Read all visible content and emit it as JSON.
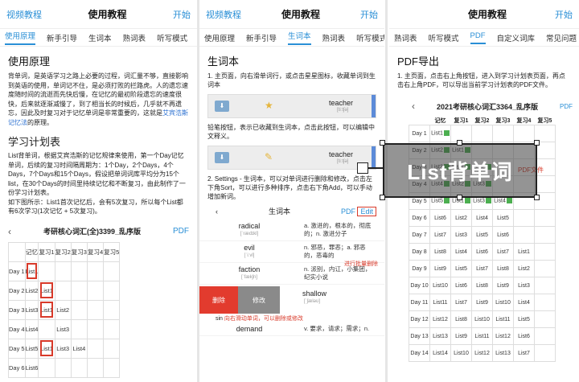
{
  "panel1": {
    "top_left": "视频教程",
    "title": "使用教程",
    "top_right": "开始",
    "tabs": [
      "使用原理",
      "新手引导",
      "生词本",
      "熟词表",
      "听写模式"
    ],
    "heading": "使用原理",
    "para1": "背单词，是英语学习之路上必要的过程，词汇量不够，直接影响到英语的使用，单词记不住，是必须打败的拦路虎。人的遗忘速度随时间的流逝而先快后慢，在记忆的最初阶段遗忘的速度很快，后来就逐渐减慢了，到了相当长的时候后，几乎就不再遗忘，因此及时复习对于记忆单词是非常重要的，这就是",
    "para1_link": "艾宾浩斯记忆法",
    "para1_end": "的原理。",
    "sub_heading": "学习计划表",
    "para2": "List背单词，根据艾宾浩斯的记忆规律来使用，第一个Day记忆单词，后续的复习时间隔周期为：1个Day，2个Days，4个Days，7个Days和15个Days，假设把单词词库平均分为15个list，在30个Days的时间里持续记忆和不断复习，由此制作了一份学习计划表。",
    "para3": "如下图所示：List1首次记忆后，会有5次复习，所以每个List都有6次学习(1次记忆 + 5次复习)。",
    "table_title": "考研核心词汇(全)3399_乱序版",
    "table_back": "‹",
    "table_pdf": "PDF",
    "table_headers": [
      "",
      "记忆",
      "复习1",
      "复习2",
      "复习3",
      "复习4",
      "复习5"
    ],
    "table_rows": [
      [
        "Day 1",
        "List1",
        "",
        "",
        "",
        "",
        ""
      ],
      [
        "Day 2",
        "List2",
        "List1",
        "",
        "",
        "",
        ""
      ],
      [
        "Day 3",
        "List3",
        "List1",
        "List2",
        "",
        "",
        ""
      ],
      [
        "Day 4",
        "List4",
        "",
        "List3",
        "",
        "",
        ""
      ],
      [
        "Day 5",
        "List5",
        "List1",
        "List3",
        "List4",
        "",
        ""
      ],
      [
        "Day 6",
        "List6",
        "",
        "",
        "",
        "",
        ""
      ]
    ]
  },
  "panel2": {
    "top_left": "视频教程",
    "title": "使用教程",
    "top_right": "开始",
    "tabs": [
      "使用原理",
      "新手引导",
      "生词本",
      "熟词表",
      "听写模式"
    ],
    "heading": "生词本",
    "step1": "1. 主页面，向右滑单词行，或点击星星图标，收藏单词到生词本",
    "shot1_word": "teacher",
    "shot1_ipa": "[tiːtʃə]",
    "step1b": "铅笔按钮，表示已收藏到生词本，点击此按钮，可以编辑中文释义。",
    "shot2_word": "teacher",
    "shot2_ipa": "[tiːtʃə]",
    "step2": "2. Settings - 生词本，可以对单词进行删除和修改，点击左下角Sort，可以进行多种排序，点击右下角Add，可以手动增加新词。",
    "wl_title": "生词本",
    "wl_pdf": "PDF",
    "wl_edit": "Edit",
    "wl_rows": [
      {
        "w": "radical",
        "ipa": "[ˈrædɪkl]",
        "def": "a. 激进的，根本的，彻底的；n. 激进分子"
      },
      {
        "w": "evil",
        "ipa": "[ˈiːvl]",
        "def": "n. 邪恶，罪恶；a. 邪恶的，恶毒的"
      },
      {
        "w": "faction",
        "ipa": "[ˈfækʃn]",
        "def": "n. 派别，内讧，小集团，纪实小说"
      }
    ],
    "annot1": "进行批量删除",
    "swipe_del": "删除",
    "swipe_mod": "修改",
    "swipe_word": "shallow",
    "swipe_ipa": "[ˈʃæləʊ]",
    "swipe_word2": "sin",
    "annot2": "向右滑动单词，可以删除或修改",
    "last_w": "demand",
    "last_def": "v. 要求，请求；需求；n."
  },
  "panel3": {
    "top_right": "开始",
    "title": "使用教程",
    "tabs": [
      "熟词表",
      "听写模式",
      "PDF",
      "自定义词库",
      "常见问题"
    ],
    "heading": "PDF导出",
    "step1": "1. 主页面，点击右上角按钮，进入到学习计划表页面，再点击右上角PDF，可以导出当前学习计划表的PDF文件。",
    "table_title": "2021考研核心词汇3364_乱序版",
    "table_back": "‹",
    "table_pdf": "PDF",
    "pdf_note": "PDF文件",
    "overlay_label": "List背单词",
    "headers": [
      "",
      "记忆",
      "复习1",
      "复习2",
      "复习3",
      "复习4",
      "复习5"
    ],
    "rows": [
      [
        "Day 1",
        "List1",
        "",
        "",
        "",
        "",
        ""
      ],
      [
        "Day 2",
        "List2",
        "List1",
        "",
        "",
        "",
        ""
      ],
      [
        "Day 3",
        "List3",
        "List1",
        "List2",
        "",
        "",
        ""
      ],
      [
        "Day 4",
        "List4",
        "List2",
        "List3",
        "",
        "",
        ""
      ],
      [
        "Day 5",
        "List5",
        "List1",
        "List3",
        "List4",
        "",
        ""
      ],
      [
        "Day 6",
        "List6",
        "List2",
        "List4",
        "List5",
        "",
        ""
      ],
      [
        "Day 7",
        "List7",
        "List3",
        "List5",
        "List6",
        "",
        ""
      ],
      [
        "Day 8",
        "List8",
        "List4",
        "List6",
        "List7",
        "List1",
        ""
      ],
      [
        "Day 9",
        "List9",
        "List5",
        "List7",
        "List8",
        "List2",
        ""
      ],
      [
        "Day 10",
        "List10",
        "List6",
        "List8",
        "List9",
        "List3",
        ""
      ],
      [
        "Day 11",
        "List11",
        "List7",
        "List9",
        "List10",
        "List4",
        ""
      ],
      [
        "Day 12",
        "List12",
        "List8",
        "List10",
        "List11",
        "List5",
        ""
      ],
      [
        "Day 13",
        "List13",
        "List9",
        "List11",
        "List12",
        "List6",
        ""
      ],
      [
        "Day 14",
        "List14",
        "List10",
        "List12",
        "List13",
        "List7",
        ""
      ]
    ]
  }
}
